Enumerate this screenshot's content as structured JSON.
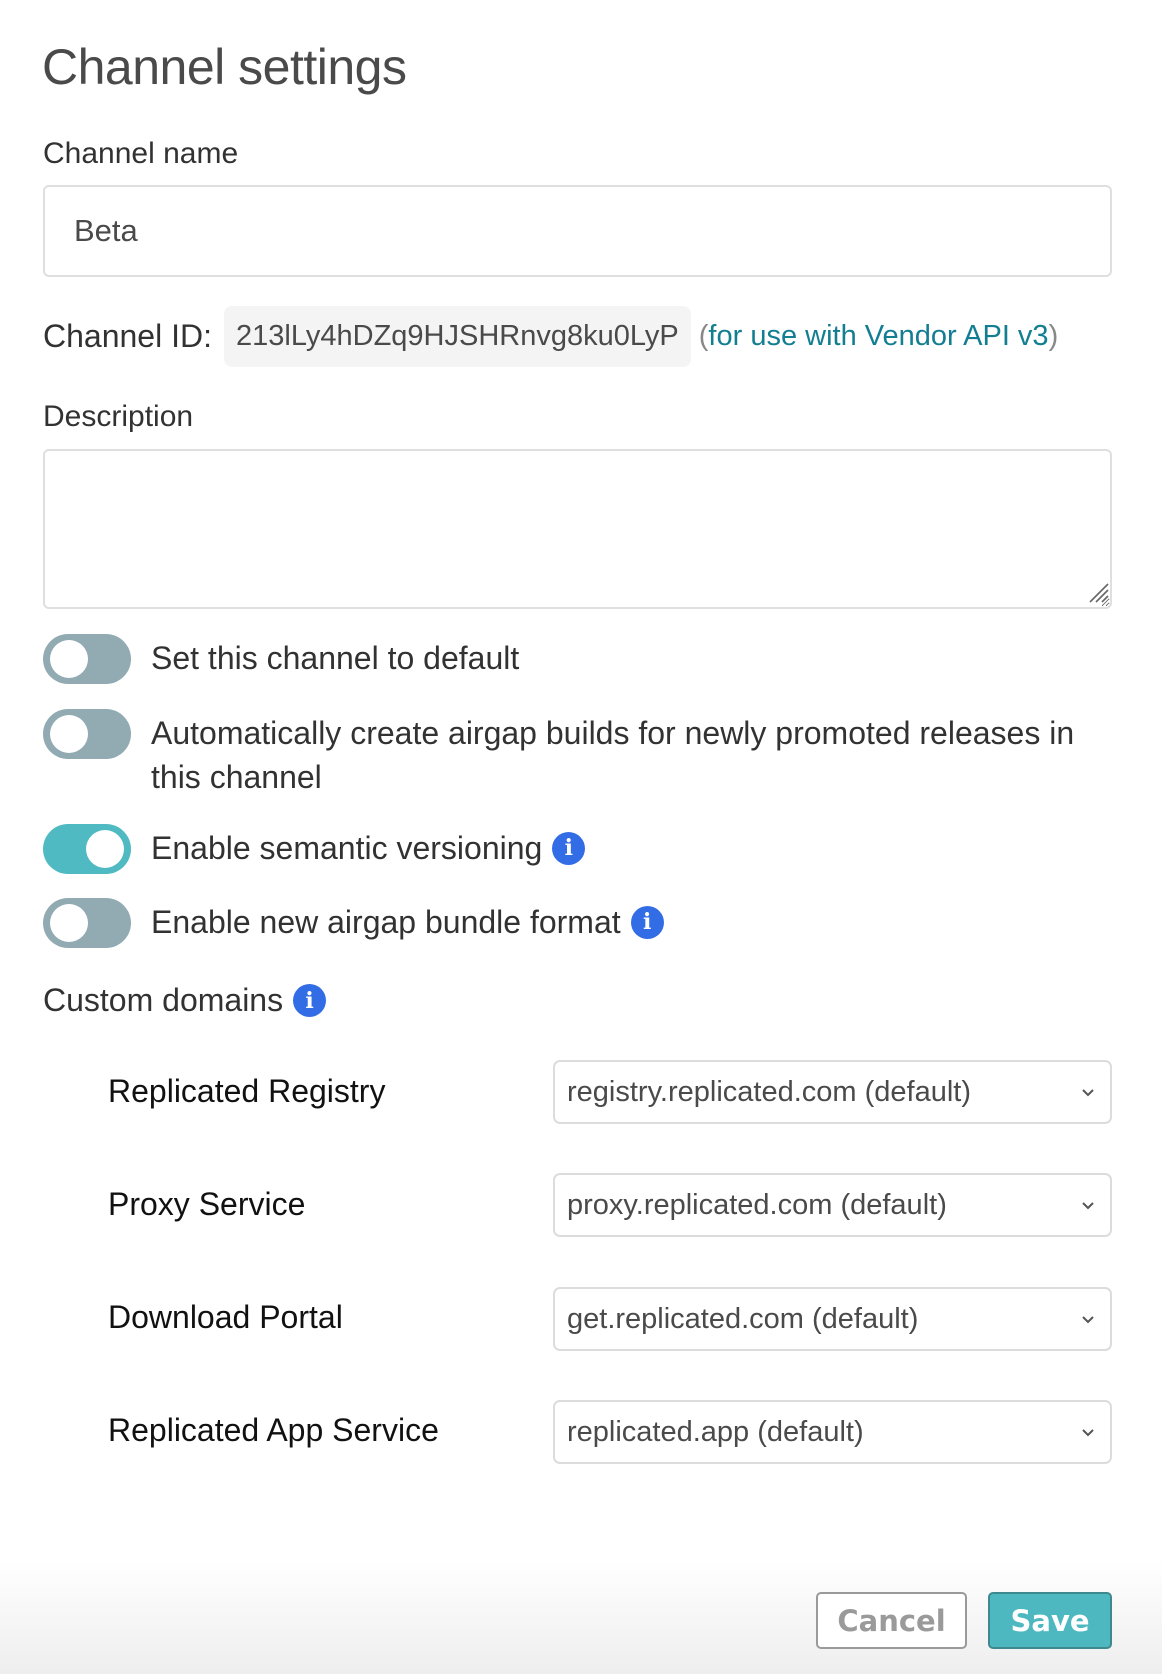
{
  "page": {
    "title": "Channel settings"
  },
  "channel_name": {
    "label": "Channel name",
    "value": "Beta",
    "placeholder": ""
  },
  "channel_id": {
    "label": "Channel ID:",
    "value": "213lLy4hDZq9HJSHRnvg8ku0LyP",
    "paren_open": "(",
    "link_text": "for use with Vendor API v3",
    "paren_close": ")"
  },
  "description": {
    "label": "Description",
    "value": "",
    "placeholder": ""
  },
  "toggles": [
    {
      "label": "Set this channel to default",
      "on": false,
      "has_info": false
    },
    {
      "label": "Automatically create airgap builds for newly promoted releases in this channel",
      "on": false,
      "has_info": false
    },
    {
      "label": "Enable semantic versioning",
      "on": true,
      "has_info": true
    },
    {
      "label": "Enable new airgap bundle format",
      "on": false,
      "has_info": true
    }
  ],
  "custom_domains": {
    "title": "Custom domains",
    "info_glyph": "i",
    "rows": [
      {
        "label": "Replicated Registry",
        "value": "registry.replicated.com (default)"
      },
      {
        "label": "Proxy Service",
        "value": "proxy.replicated.com (default)"
      },
      {
        "label": "Download Portal",
        "value": "get.replicated.com (default)"
      },
      {
        "label": "Replicated App Service",
        "value": "replicated.app (default)"
      }
    ]
  },
  "icons": {
    "info": "info-icon",
    "chevron": "chevron-down-icon",
    "resize": "resize-grip-icon"
  },
  "colors": {
    "toggle_on": "#4fbac1",
    "toggle_off": "#92abb2",
    "info": "#326de6",
    "link": "#137e92",
    "save": "#4db8c0"
  },
  "buttons": {
    "cancel": "Cancel",
    "save": "Save"
  }
}
